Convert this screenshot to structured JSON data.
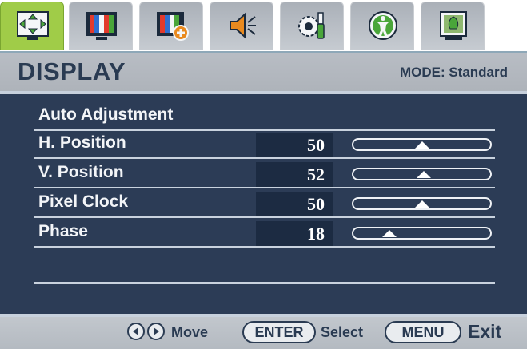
{
  "tabs": [
    {
      "icon": "display-position-icon",
      "active": true
    },
    {
      "icon": "picture-icon",
      "active": false
    },
    {
      "icon": "picture-advanced-icon",
      "active": false
    },
    {
      "icon": "audio-icon",
      "active": false
    },
    {
      "icon": "system-settings-icon",
      "active": false
    },
    {
      "icon": "eco-icon",
      "active": false
    },
    {
      "icon": "display-info-icon",
      "active": false
    }
  ],
  "header": {
    "title": "DISPLAY",
    "mode": "MODE: Standard"
  },
  "menu": {
    "auto_adjust": "Auto Adjustment",
    "rows": [
      {
        "label": "H. Position",
        "value": "50",
        "level": 50
      },
      {
        "label": "V. Position",
        "value": "52",
        "level": 52
      },
      {
        "label": "Pixel Clock",
        "value": "50",
        "level": 50
      },
      {
        "label": "Phase",
        "value": "18",
        "level": 18
      }
    ]
  },
  "footer": {
    "move": "Move",
    "enter": "ENTER",
    "select": "Select",
    "menu": "MENU",
    "exit": "Exit"
  },
  "colors": {
    "active_tab": "#a0cc48",
    "panel": "#2c3c56",
    "value_box": "#1c2b42",
    "text_dark": "#2a3b52"
  }
}
